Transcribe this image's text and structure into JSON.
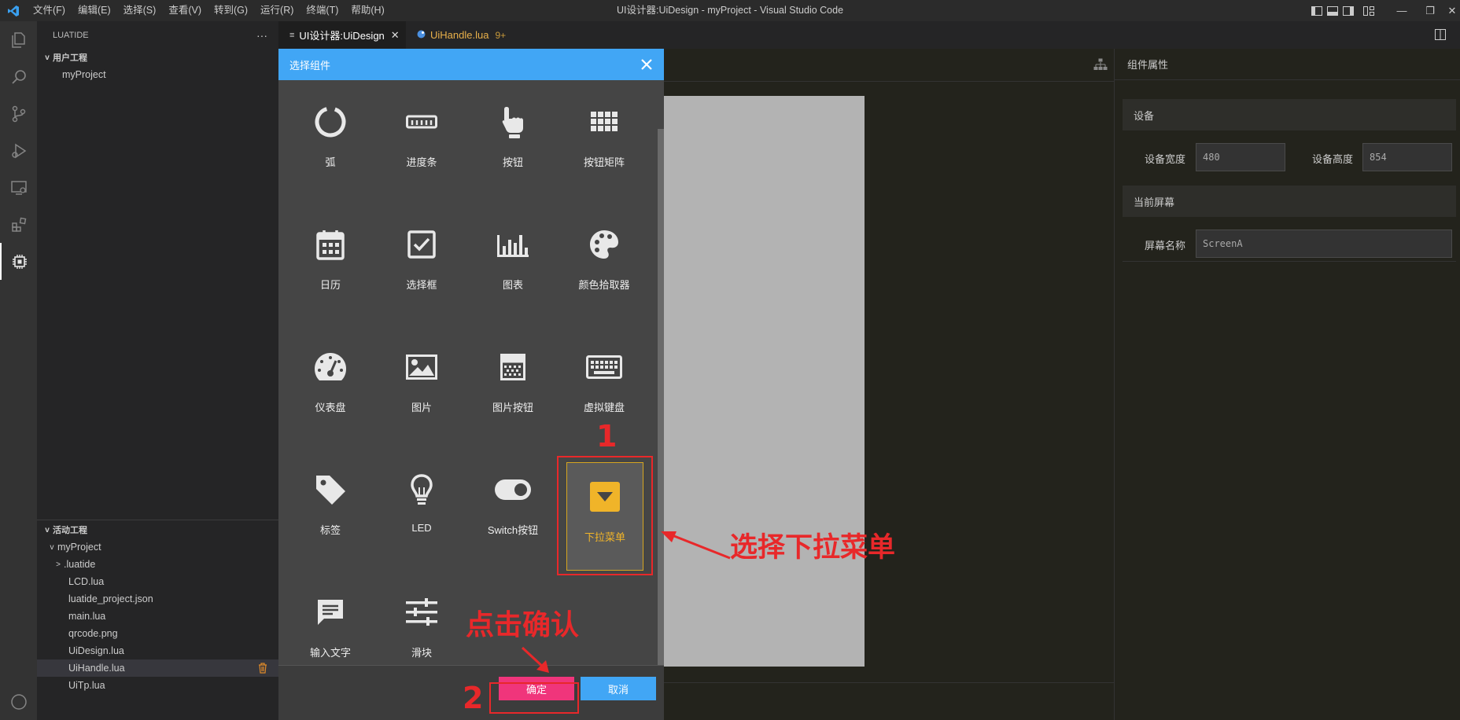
{
  "window": {
    "title": "UI设计器:UiDesign - myProject - Visual Studio Code",
    "menu": [
      "文件(F)",
      "编辑(E)",
      "选择(S)",
      "查看(V)",
      "转到(G)",
      "运行(R)",
      "终端(T)",
      "帮助(H)"
    ]
  },
  "sidebar": {
    "header": "LUATIDE",
    "more": "···",
    "user_section": "用户工程",
    "user_items": [
      "myProject"
    ],
    "active_section": "活动工程",
    "active_root": "myProject",
    "files": [
      ".luatide",
      "LCD.lua",
      "luatide_project.json",
      "main.lua",
      "qrcode.png",
      "UiDesign.lua",
      "UiHandle.lua",
      "UiTp.lua"
    ]
  },
  "tabs": [
    {
      "label": "UI设计器:UiDesign"
    },
    {
      "label": "UiHandle.lua",
      "badge": "9+"
    }
  ],
  "dialog": {
    "title": "选择组件",
    "components": [
      "弧",
      "进度条",
      "按钮",
      "按钮矩阵",
      "日历",
      "选择框",
      "图表",
      "颜色拾取器",
      "仪表盘",
      "图片",
      "图片按钮",
      "虚拟键盘",
      "标签",
      "LED",
      "Switch按钮",
      "下拉菜单",
      "输入文字",
      "滑块"
    ],
    "selected": "下拉菜单",
    "confirm": "确定",
    "cancel": "取消"
  },
  "props": {
    "title": "组件属性",
    "device_section": "设备",
    "width_label": "设备宽度",
    "width_value": "480",
    "height_label": "设备高度",
    "height_value": "854",
    "screen_section": "当前屏幕",
    "screen_label": "屏幕名称",
    "screen_value": "ScreenA"
  },
  "annotations": {
    "step1": "1",
    "step1_text": "选择下拉菜单",
    "step2": "2",
    "step2_text": "点击确认"
  },
  "colors": {
    "dialog_header": "#41a6f5",
    "confirm": "#f0357b",
    "selected_border": "#d6a520",
    "annotation": "#e8282a"
  }
}
